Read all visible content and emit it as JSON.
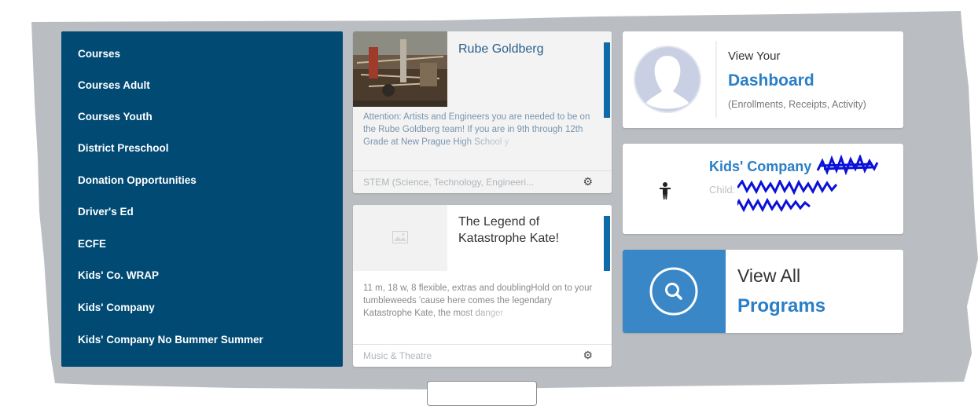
{
  "sidebar": {
    "items": [
      {
        "label": "Courses"
      },
      {
        "label": "Courses Adult"
      },
      {
        "label": "Courses Youth"
      },
      {
        "label": "District Preschool"
      },
      {
        "label": "Donation Opportunities"
      },
      {
        "label": "Driver's Ed"
      },
      {
        "label": "ECFE"
      },
      {
        "label": "Kids' Co. WRAP"
      },
      {
        "label": "Kids' Company"
      },
      {
        "label": "Kids' Company No Bummer Summer"
      }
    ]
  },
  "cards": [
    {
      "title": "Rube Goldberg",
      "description": "Attention: Artists and Engineers you are needed to be on the Rube Goldberg team!  If you are in 9th through 12th Grade at New Prague High School y",
      "category": "STEM (Science, Technology, Engineeri...",
      "image_icon": "photo-thumbnail",
      "settings_icon": "gear-icon"
    },
    {
      "title": "The Legend of Katastrophe Kate!",
      "description": "11 m, 18 w, 8 flexible, extras and doublingHold on to your tumbleweeds 'cause here comes the legendary Katastrophe Kate, the most danger",
      "category": "Music & Theatre",
      "image_icon": "image-placeholder-icon",
      "settings_icon": "gear-icon"
    }
  ],
  "dashboard_panel": {
    "pre_title": "View Your",
    "title": "Dashboard",
    "subtitle": "(Enrollments, Receipts, Activity)",
    "icon": "avatar-silhouette-icon"
  },
  "enrollment_panel": {
    "title": "Kids' Company",
    "child_label": "Child:",
    "icon": "child-icon"
  },
  "programs_panel": {
    "line1": "View All",
    "line2": "Programs",
    "icon": "search-icon"
  },
  "colors": {
    "sidebar_bg": "#004a74",
    "accent_blue": "#0f6aa8",
    "programs_blue": "#3a87c8",
    "link_blue": "#2a7fc6",
    "backdrop_gray": "#babec2"
  }
}
